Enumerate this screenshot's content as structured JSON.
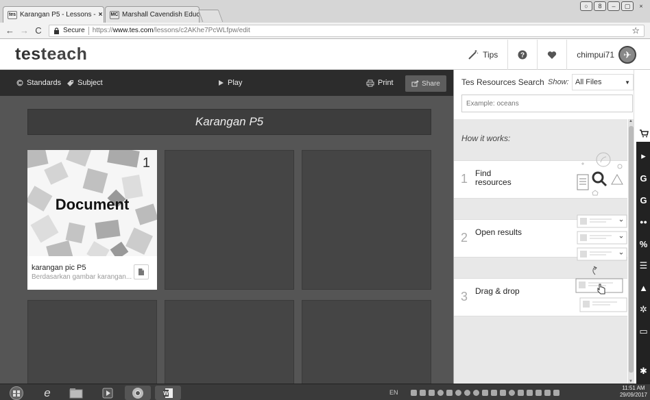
{
  "browser": {
    "tabs": [
      {
        "favicon": "tes",
        "title": "Karangan P5 - Lessons -",
        "close": "×"
      },
      {
        "favicon": "MC",
        "title": "Marshall Cavendish Educ",
        "close": "×"
      }
    ],
    "secure_label": "Secure",
    "url_prefix": "https://",
    "url_host": "www.tes.com",
    "url_path": "/lessons/c2AKhe7PcWLfpw/edit",
    "star_icon": "star-icon"
  },
  "header": {
    "logo_bold": "tes",
    "logo_light": "teach",
    "tips_label": "Tips",
    "username": "chimpui71"
  },
  "toolbar": {
    "standards": "Standards",
    "subject": "Subject",
    "play": "Play",
    "print": "Print",
    "share": "Share"
  },
  "lesson": {
    "title": "Karangan P5",
    "card": {
      "number": "1",
      "label": "Document",
      "title": "karangan pic P5",
      "description": "Berdasarkan gambar karangan..."
    }
  },
  "resources": {
    "title": "Tes Resources Search",
    "show_label": "Show:",
    "filter_value": "All Files",
    "search_placeholder": "Example: oceans",
    "how_it_works": "How it works:",
    "steps": [
      {
        "num": "1",
        "label": "Find resources"
      },
      {
        "num": "2",
        "label": "Open results"
      },
      {
        "num": "3",
        "label": "Drag & drop"
      }
    ]
  },
  "rail": {
    "icons": [
      "cart-icon",
      "youtube-icon",
      "google-icon",
      "google-scholar-icon",
      "flickr-icon",
      "link-icon",
      "layers-icon",
      "google-drive-icon",
      "dropbox-icon",
      "computer-icon",
      "settings-icon"
    ],
    "glyphs": [
      "▸",
      "G",
      "G",
      "●●",
      "%",
      "☰",
      "▲",
      "✲",
      "▭",
      "✱"
    ]
  },
  "taskbar": {
    "lang": "EN",
    "time": "11:51 AM",
    "date": "29/09/2017"
  }
}
